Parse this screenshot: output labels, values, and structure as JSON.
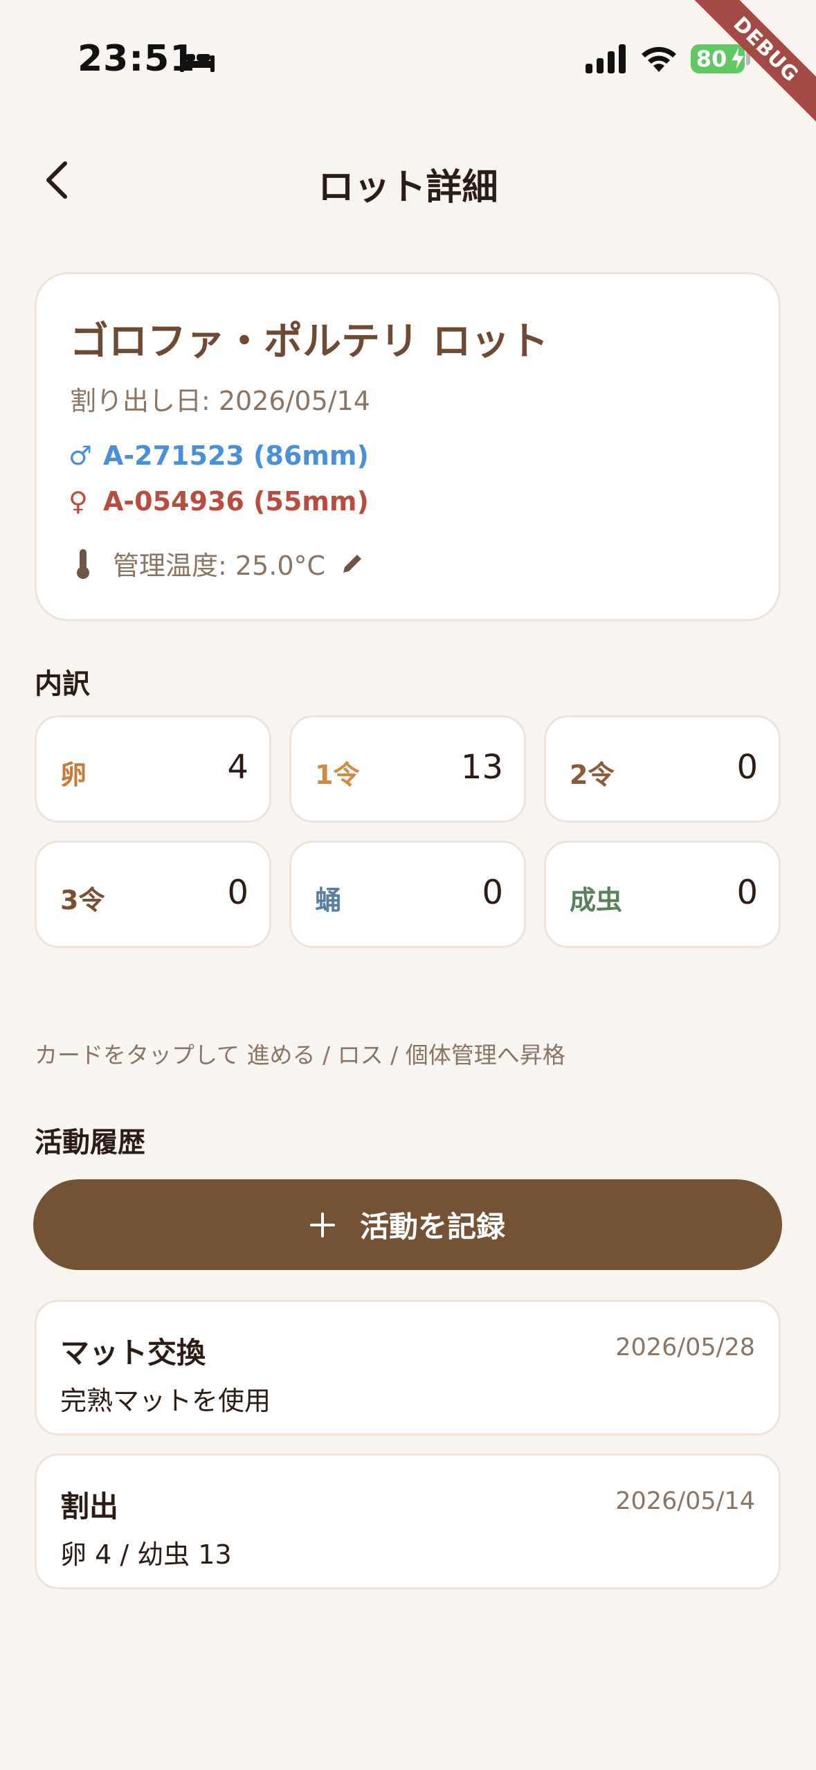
{
  "status_bar": {
    "time": "23:51",
    "battery": "80",
    "debug": "DEBUG"
  },
  "header": {
    "title": "ロット詳細"
  },
  "lot": {
    "name": "ゴロファ・ポルテリ ロット",
    "split_date": "割り出し日: 2026/05/14",
    "male_symbol": "♂",
    "male": "A-271523 (86mm)",
    "female_symbol": "♀",
    "female": "A-054936 (55mm)",
    "temperature": "管理温度: 25.0°C"
  },
  "breakdown": {
    "label": "内訳",
    "stages": [
      {
        "label": "卵",
        "count": "4",
        "color": "#c77a3a"
      },
      {
        "label": "1令",
        "count": "13",
        "color": "#d08a45"
      },
      {
        "label": "2令",
        "count": "0",
        "color": "#8a5a3a"
      },
      {
        "label": "3令",
        "count": "0",
        "color": "#7a4e32"
      },
      {
        "label": "蛹",
        "count": "0",
        "color": "#5b7fa0"
      },
      {
        "label": "成虫",
        "count": "0",
        "color": "#5c7f5e"
      }
    ]
  },
  "hint": "カードをタップして 進める / ロス / 個体管理へ昇格",
  "activity": {
    "label": "活動履歴",
    "record_button": "活動を記録",
    "items": [
      {
        "title": "マット交換",
        "date": "2026/05/28",
        "desc": "完熟マットを使用"
      },
      {
        "title": "割出",
        "date": "2026/05/14",
        "desc": "卵 4 / 幼虫 13"
      }
    ]
  },
  "colors": {
    "background": "#f8f5f1",
    "accent": "#765234",
    "male": "#4a90d9",
    "female": "#b84c3e"
  }
}
